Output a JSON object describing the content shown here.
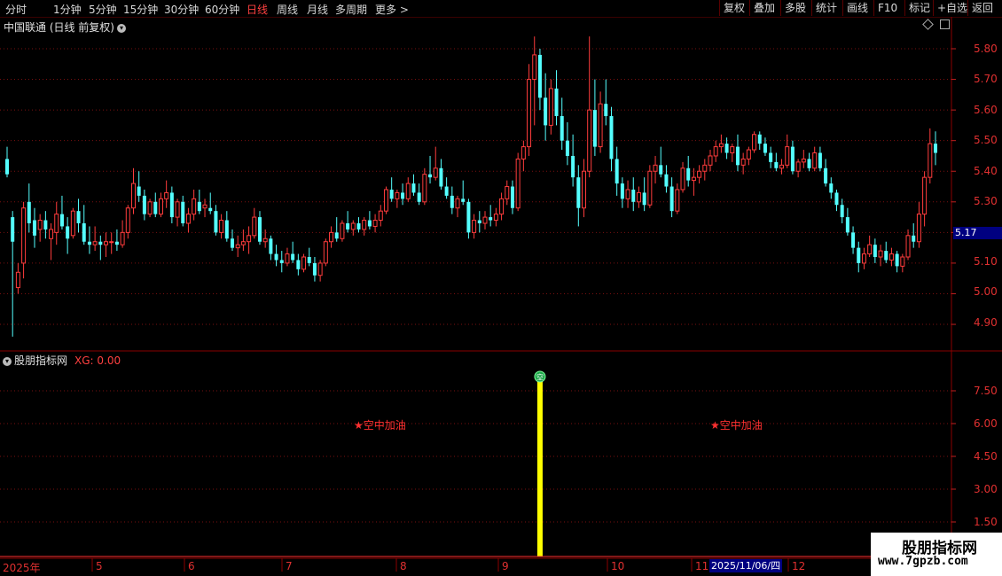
{
  "periods": [
    "分时",
    "1分钟",
    "5分钟",
    "15分钟",
    "30分钟",
    "60分钟",
    "日线",
    "周线",
    "月线",
    "多周期",
    "更多 >"
  ],
  "active_period": "日线",
  "toolbar": [
    "复权",
    "叠加",
    "多股",
    "统计",
    "画线",
    "F10",
    "标记",
    "+自选",
    "返回"
  ],
  "main_title": "中国联通 (日线 前复权)",
  "indicator": {
    "name": "股朋指标网",
    "xg_label": "XG: 0.00"
  },
  "price_axis": [
    "5.80",
    "5.70",
    "5.60",
    "5.50",
    "5.40",
    "5.30",
    "5.20",
    "5.10",
    "5.00",
    "4.90"
  ],
  "current_price": "5.17",
  "indicator_axis": [
    "7.50",
    "6.00",
    "4.50",
    "3.00",
    "1.50"
  ],
  "date_axis": [
    "2025年",
    "5",
    "6",
    "7",
    "8",
    "9",
    "10",
    "11",
    "12"
  ],
  "highlight_date": "2025/11/06/四",
  "signal_label": "★空中加油",
  "signal_icon_glyph": "空",
  "watermark": {
    "line1": "股朋指标网",
    "line2": "www.7gpzb.com"
  },
  "colors": {
    "up": "#ff3c3c",
    "down": "#54ffff",
    "signal_bar": "#ffff00",
    "axis": "#e03030"
  },
  "chart_data": {
    "type": "candlestick",
    "ylim": [
      4.85,
      5.85
    ],
    "signal_dates_index": [
      97,
      197
    ],
    "candles": [
      [
        5.44,
        5.48,
        5.38,
        5.39
      ],
      [
        5.25,
        5.27,
        4.86,
        5.17
      ],
      [
        5.02,
        5.1,
        5.0,
        5.07
      ],
      [
        5.1,
        5.3,
        5.05,
        5.28
      ],
      [
        5.3,
        5.36,
        5.2,
        5.23
      ],
      [
        5.24,
        5.28,
        5.15,
        5.19
      ],
      [
        5.21,
        5.26,
        5.17,
        5.24
      ],
      [
        5.24,
        5.27,
        5.18,
        5.21
      ],
      [
        5.18,
        5.23,
        5.11,
        5.21
      ],
      [
        5.2,
        5.3,
        5.16,
        5.26
      ],
      [
        5.26,
        5.32,
        5.21,
        5.22
      ],
      [
        5.22,
        5.25,
        5.13,
        5.18
      ],
      [
        5.19,
        5.28,
        5.18,
        5.27
      ],
      [
        5.27,
        5.31,
        5.2,
        5.23
      ],
      [
        5.23,
        5.29,
        5.16,
        5.17
      ],
      [
        5.17,
        5.22,
        5.13,
        5.16
      ],
      [
        5.16,
        5.22,
        5.14,
        5.17
      ],
      [
        5.17,
        5.19,
        5.11,
        5.16
      ],
      [
        5.16,
        5.2,
        5.12,
        5.17
      ],
      [
        5.17,
        5.2,
        5.13,
        5.17
      ],
      [
        5.17,
        5.21,
        5.14,
        5.16
      ],
      [
        5.16,
        5.24,
        5.15,
        5.2
      ],
      [
        5.2,
        5.29,
        5.18,
        5.28
      ],
      [
        5.28,
        5.41,
        5.26,
        5.36
      ],
      [
        5.35,
        5.4,
        5.3,
        5.32
      ],
      [
        5.32,
        5.34,
        5.24,
        5.26
      ],
      [
        5.26,
        5.31,
        5.25,
        5.3
      ],
      [
        5.3,
        5.33,
        5.25,
        5.26
      ],
      [
        5.26,
        5.33,
        5.25,
        5.31
      ],
      [
        5.31,
        5.37,
        5.28,
        5.33
      ],
      [
        5.33,
        5.35,
        5.23,
        5.25
      ],
      [
        5.25,
        5.31,
        5.22,
        5.3
      ],
      [
        5.3,
        5.32,
        5.22,
        5.23
      ],
      [
        5.23,
        5.28,
        5.2,
        5.26
      ],
      [
        5.26,
        5.34,
        5.24,
        5.31
      ],
      [
        5.3,
        5.34,
        5.26,
        5.27
      ],
      [
        5.28,
        5.31,
        5.25,
        5.29
      ],
      [
        5.28,
        5.33,
        5.26,
        5.27
      ],
      [
        5.27,
        5.29,
        5.19,
        5.2
      ],
      [
        5.2,
        5.26,
        5.18,
        5.24
      ],
      [
        5.24,
        5.27,
        5.17,
        5.18
      ],
      [
        5.18,
        5.21,
        5.14,
        5.15
      ],
      [
        5.15,
        5.19,
        5.12,
        5.16
      ],
      [
        5.16,
        5.21,
        5.14,
        5.17
      ],
      [
        5.17,
        5.22,
        5.13,
        5.19
      ],
      [
        5.19,
        5.28,
        5.18,
        5.25
      ],
      [
        5.25,
        5.27,
        5.16,
        5.17
      ],
      [
        5.17,
        5.21,
        5.15,
        5.18
      ],
      [
        5.18,
        5.19,
        5.11,
        5.13
      ],
      [
        5.13,
        5.16,
        5.09,
        5.11
      ],
      [
        5.11,
        5.14,
        5.07,
        5.1
      ],
      [
        5.1,
        5.15,
        5.09,
        5.13
      ],
      [
        5.13,
        5.17,
        5.1,
        5.11
      ],
      [
        5.11,
        5.13,
        5.06,
        5.08
      ],
      [
        5.08,
        5.13,
        5.07,
        5.12
      ],
      [
        5.12,
        5.15,
        5.09,
        5.1
      ],
      [
        5.1,
        5.12,
        5.04,
        5.06
      ],
      [
        5.06,
        5.11,
        5.04,
        5.1
      ],
      [
        5.1,
        5.18,
        5.09,
        5.17
      ],
      [
        5.17,
        5.22,
        5.15,
        5.2
      ],
      [
        5.2,
        5.25,
        5.17,
        5.18
      ],
      [
        5.18,
        5.24,
        5.17,
        5.23
      ],
      [
        5.23,
        5.27,
        5.2,
        5.21
      ],
      [
        5.21,
        5.24,
        5.19,
        5.23
      ],
      [
        5.23,
        5.25,
        5.2,
        5.21
      ],
      [
        5.21,
        5.25,
        5.19,
        5.24
      ],
      [
        5.24,
        5.27,
        5.21,
        5.22
      ],
      [
        5.22,
        5.26,
        5.2,
        5.24
      ],
      [
        5.24,
        5.29,
        5.22,
        5.27
      ],
      [
        5.27,
        5.35,
        5.26,
        5.34
      ],
      [
        5.34,
        5.38,
        5.3,
        5.31
      ],
      [
        5.31,
        5.34,
        5.28,
        5.33
      ],
      [
        5.33,
        5.36,
        5.29,
        5.31
      ],
      [
        5.31,
        5.38,
        5.3,
        5.36
      ],
      [
        5.36,
        5.39,
        5.32,
        5.33
      ],
      [
        5.33,
        5.36,
        5.29,
        5.3
      ],
      [
        5.3,
        5.41,
        5.29,
        5.39
      ],
      [
        5.39,
        5.45,
        5.36,
        5.38
      ],
      [
        5.38,
        5.48,
        5.37,
        5.41
      ],
      [
        5.41,
        5.44,
        5.34,
        5.35
      ],
      [
        5.35,
        5.38,
        5.31,
        5.32
      ],
      [
        5.32,
        5.35,
        5.26,
        5.28
      ],
      [
        5.28,
        5.32,
        5.25,
        5.31
      ],
      [
        5.31,
        5.37,
        5.29,
        5.3
      ],
      [
        5.3,
        5.31,
        5.18,
        5.2
      ],
      [
        5.2,
        5.26,
        5.18,
        5.24
      ],
      [
        5.24,
        5.27,
        5.2,
        5.23
      ],
      [
        5.23,
        5.27,
        5.21,
        5.25
      ],
      [
        5.25,
        5.29,
        5.22,
        5.24
      ],
      [
        5.24,
        5.28,
        5.22,
        5.26
      ],
      [
        5.26,
        5.33,
        5.24,
        5.31
      ],
      [
        5.31,
        5.37,
        5.29,
        5.35
      ],
      [
        5.35,
        5.37,
        5.26,
        5.28
      ],
      [
        5.28,
        5.46,
        5.27,
        5.44
      ],
      [
        5.44,
        5.5,
        5.4,
        5.48
      ],
      [
        5.48,
        5.75,
        5.45,
        5.7
      ],
      [
        5.7,
        5.84,
        5.55,
        5.78
      ],
      [
        5.78,
        5.8,
        5.6,
        5.64
      ],
      [
        5.64,
        5.72,
        5.5,
        5.55
      ],
      [
        5.55,
        5.7,
        5.52,
        5.67
      ],
      [
        5.67,
        5.73,
        5.55,
        5.58
      ],
      [
        5.58,
        5.64,
        5.47,
        5.5
      ],
      [
        5.5,
        5.56,
        5.42,
        5.45
      ],
      [
        5.45,
        5.52,
        5.35,
        5.38
      ],
      [
        5.38,
        5.42,
        5.22,
        5.28
      ],
      [
        5.28,
        5.44,
        5.25,
        5.4
      ],
      [
        5.4,
        5.84,
        5.38,
        5.6
      ],
      [
        5.6,
        5.7,
        5.45,
        5.48
      ],
      [
        5.48,
        5.66,
        5.46,
        5.62
      ],
      [
        5.62,
        5.7,
        5.55,
        5.58
      ],
      [
        5.58,
        5.61,
        5.4,
        5.44
      ],
      [
        5.44,
        5.48,
        5.32,
        5.36
      ],
      [
        5.36,
        5.38,
        5.28,
        5.31
      ],
      [
        5.31,
        5.37,
        5.28,
        5.34
      ],
      [
        5.34,
        5.38,
        5.27,
        5.3
      ],
      [
        5.3,
        5.35,
        5.28,
        5.33
      ],
      [
        5.33,
        5.38,
        5.27,
        5.29
      ],
      [
        5.29,
        5.42,
        5.28,
        5.4
      ],
      [
        5.4,
        5.45,
        5.36,
        5.42
      ],
      [
        5.42,
        5.48,
        5.38,
        5.39
      ],
      [
        5.39,
        5.42,
        5.33,
        5.35
      ],
      [
        5.35,
        5.38,
        5.25,
        5.27
      ],
      [
        5.27,
        5.36,
        5.26,
        5.34
      ],
      [
        5.34,
        5.43,
        5.33,
        5.41
      ],
      [
        5.41,
        5.45,
        5.35,
        5.37
      ],
      [
        5.37,
        5.41,
        5.32,
        5.38
      ],
      [
        5.38,
        5.42,
        5.36,
        5.4
      ],
      [
        5.4,
        5.44,
        5.37,
        5.42
      ],
      [
        5.42,
        5.47,
        5.4,
        5.45
      ],
      [
        5.45,
        5.5,
        5.43,
        5.48
      ],
      [
        5.48,
        5.52,
        5.46,
        5.49
      ],
      [
        5.49,
        5.51,
        5.44,
        5.46
      ],
      [
        5.46,
        5.49,
        5.43,
        5.48
      ],
      [
        5.48,
        5.52,
        5.4,
        5.42
      ],
      [
        5.42,
        5.46,
        5.39,
        5.44
      ],
      [
        5.44,
        5.48,
        5.42,
        5.47
      ],
      [
        5.47,
        5.53,
        5.46,
        5.52
      ],
      [
        5.52,
        5.53,
        5.47,
        5.49
      ],
      [
        5.49,
        5.51,
        5.45,
        5.46
      ],
      [
        5.46,
        5.48,
        5.41,
        5.43
      ],
      [
        5.43,
        5.46,
        5.4,
        5.41
      ],
      [
        5.41,
        5.44,
        5.39,
        5.42
      ],
      [
        5.42,
        5.52,
        5.41,
        5.48
      ],
      [
        5.48,
        5.5,
        5.39,
        5.4
      ],
      [
        5.4,
        5.44,
        5.38,
        5.43
      ],
      [
        5.43,
        5.47,
        5.41,
        5.44
      ],
      [
        5.44,
        5.46,
        5.4,
        5.41
      ],
      [
        5.41,
        5.48,
        5.4,
        5.46
      ],
      [
        5.46,
        5.48,
        5.4,
        5.41
      ],
      [
        5.41,
        5.44,
        5.35,
        5.36
      ],
      [
        5.36,
        5.38,
        5.31,
        5.33
      ],
      [
        5.33,
        5.34,
        5.27,
        5.29
      ],
      [
        5.29,
        5.31,
        5.23,
        5.25
      ],
      [
        5.25,
        5.28,
        5.19,
        5.2
      ],
      [
        5.2,
        5.22,
        5.13,
        5.15
      ],
      [
        5.15,
        5.17,
        5.07,
        5.1
      ],
      [
        5.1,
        5.15,
        5.08,
        5.13
      ],
      [
        5.13,
        5.19,
        5.12,
        5.16
      ],
      [
        5.16,
        5.18,
        5.1,
        5.12
      ],
      [
        5.12,
        5.16,
        5.09,
        5.14
      ],
      [
        5.14,
        5.17,
        5.1,
        5.11
      ],
      [
        5.11,
        5.15,
        5.09,
        5.13
      ],
      [
        5.13,
        5.14,
        5.07,
        5.09
      ],
      [
        5.09,
        5.13,
        5.07,
        5.12
      ],
      [
        5.12,
        5.21,
        5.11,
        5.19
      ],
      [
        5.19,
        5.23,
        5.15,
        5.17
      ],
      [
        5.17,
        5.3,
        5.15,
        5.26
      ],
      [
        5.26,
        5.4,
        5.22,
        5.38
      ],
      [
        5.38,
        5.54,
        5.36,
        5.49
      ],
      [
        5.49,
        5.53,
        5.42,
        5.46
      ]
    ]
  }
}
